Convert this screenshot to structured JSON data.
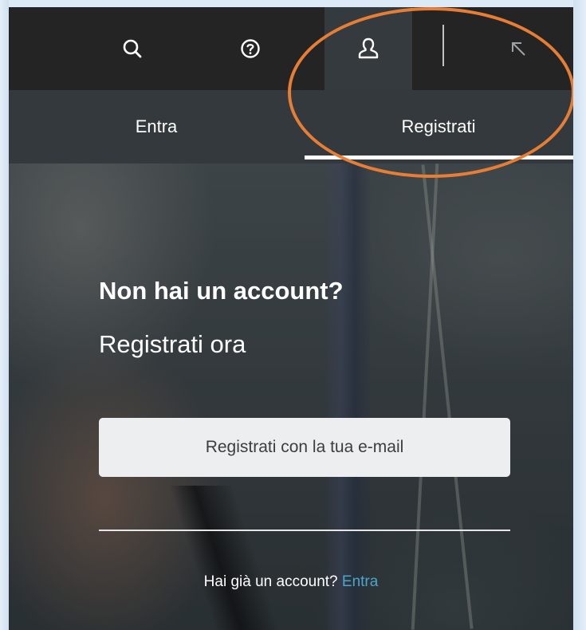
{
  "topbar": {
    "icons": {
      "search": "search-icon",
      "help": "help-icon",
      "user": "user-icon",
      "expand": "arrow-up-left-icon"
    }
  },
  "tabs": {
    "login_label": "Entra",
    "register_label": "Registrati",
    "active": "register"
  },
  "hero": {
    "title": "Non hai un account?",
    "subtitle": "Registrati ora"
  },
  "register_email_button": "Registrati con la tua e-mail",
  "login_prompt": {
    "text": "Hai già un account? ",
    "link": "Entra"
  },
  "colors": {
    "accent_link": "#4aa7c9",
    "annotation": "#e67e36",
    "topbar_bg": "#242424",
    "tabs_bg": "#33393c"
  }
}
